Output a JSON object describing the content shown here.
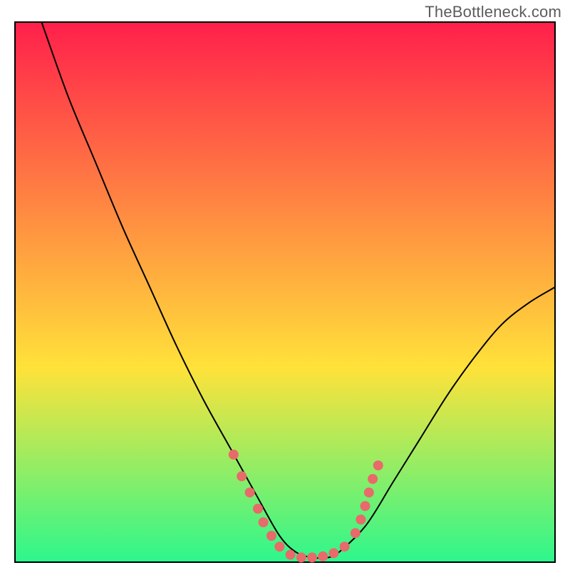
{
  "watermark": "TheBottleneck.com",
  "chart_data": {
    "type": "line",
    "title": "",
    "xlabel": "",
    "ylabel": "",
    "xlim": [
      0,
      100
    ],
    "ylim": [
      0,
      100
    ],
    "grid": false,
    "legend": false,
    "background_gradient": {
      "top": "#ff1f4b",
      "mid": "#ffe23a",
      "bottom": "#2cf78d"
    },
    "series": [
      {
        "name": "bottleneck-curve",
        "x": [
          5,
          10,
          15,
          20,
          25,
          30,
          35,
          40,
          45,
          49,
          52,
          55,
          58,
          60,
          65,
          70,
          75,
          80,
          85,
          90,
          95,
          100
        ],
        "y": [
          100,
          86,
          74,
          62,
          51,
          40,
          30,
          21,
          12,
          5,
          2,
          1,
          1,
          2,
          7,
          15,
          23,
          31,
          38,
          44,
          48,
          51
        ],
        "color": "#000000",
        "width": 2
      }
    ],
    "markers": {
      "name": "highlight-points",
      "color": "#e86a6a",
      "radius": 7,
      "points": [
        {
          "x": 40.5,
          "y": 20
        },
        {
          "x": 42,
          "y": 16
        },
        {
          "x": 43.5,
          "y": 13
        },
        {
          "x": 45,
          "y": 10
        },
        {
          "x": 46,
          "y": 7.5
        },
        {
          "x": 47.5,
          "y": 5
        },
        {
          "x": 49,
          "y": 3
        },
        {
          "x": 51,
          "y": 1.5
        },
        {
          "x": 53,
          "y": 1
        },
        {
          "x": 55,
          "y": 1
        },
        {
          "x": 57,
          "y": 1.2
        },
        {
          "x": 59,
          "y": 1.8
        },
        {
          "x": 61,
          "y": 3
        },
        {
          "x": 63,
          "y": 5.5
        },
        {
          "x": 64,
          "y": 8
        },
        {
          "x": 64.8,
          "y": 10.5
        },
        {
          "x": 65.5,
          "y": 13
        },
        {
          "x": 66.2,
          "y": 15.5
        },
        {
          "x": 67.2,
          "y": 18
        }
      ]
    }
  }
}
